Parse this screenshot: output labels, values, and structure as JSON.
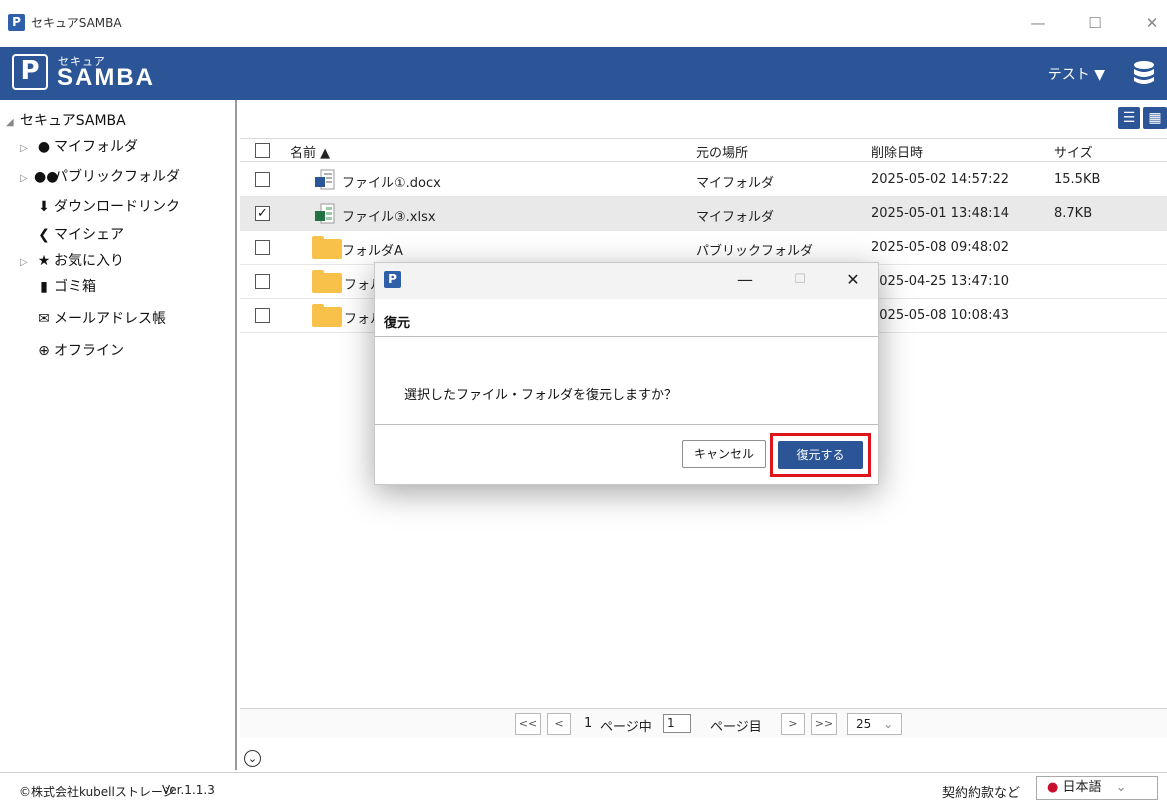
{
  "window": {
    "title": "セキュアSAMBA",
    "app_icon_glyph": "P",
    "controls": [
      "—",
      "☐",
      "✕"
    ]
  },
  "header": {
    "logo_sub": "セキュア",
    "logo_main": "SAMBA",
    "user": "テスト ▼",
    "icons": [
      "key-logo-icon",
      "database-icon"
    ],
    "bg_color": "#2b5596"
  },
  "sidebar": {
    "root": "セキュアSAMBA",
    "items": [
      {
        "label": "マイフォルダ",
        "icon": "user-icon",
        "glyph": "👤"
      },
      {
        "label": "パブリックフォルダ",
        "icon": "users-icon",
        "glyph": "👥"
      },
      {
        "label": "ダウンロードリンク",
        "icon": "download-icon",
        "glyph": "⬇"
      },
      {
        "label": "マイシェア",
        "icon": "share-icon",
        "glyph": "<"
      },
      {
        "label": "お気に入り",
        "icon": "star-icon",
        "glyph": "★"
      },
      {
        "label": "ゴミ箱",
        "icon": "trash-icon",
        "glyph": "🗑"
      },
      {
        "label": "メールアドレス帳",
        "icon": "mail-icon",
        "glyph": "✉"
      },
      {
        "label": "オフライン",
        "icon": "offline-icon",
        "glyph": "⊕"
      }
    ]
  },
  "table": {
    "columns": [
      "名前 ▲",
      "元の場所",
      "削除日時",
      "サイズ"
    ],
    "rows": [
      {
        "name": "ファイル①.docx",
        "location": "マイフォルダ",
        "deleted": "2025-05-02 14:57:22",
        "size": "15.5KB",
        "type": "docx",
        "checked": false
      },
      {
        "name": "ファイル③.xlsx",
        "location": "マイフォルダ",
        "deleted": "2025-05-01 13:48:14",
        "size": "8.7KB",
        "type": "xlsx",
        "checked": true
      },
      {
        "name": "フォルダA",
        "location": "パブリックフォルダ",
        "deleted": "2025-05-08 09:48:02",
        "size": "",
        "type": "folder",
        "checked": false
      },
      {
        "name": "フォル",
        "location": "",
        "deleted": "2025-04-25 13:47:10",
        "size": "",
        "type": "folder",
        "checked": false
      },
      {
        "name": "フォル",
        "location": "",
        "deleted": "2025-05-08 10:08:43",
        "size": "",
        "type": "folder",
        "checked": false
      }
    ]
  },
  "pager": {
    "first": "<<",
    "prev": "<",
    "total_prefix": "1",
    "of_label": "ページ中",
    "current": "1",
    "page_label": "ページ目",
    "next": ">",
    "last": ">>",
    "per_page": "25",
    "per_page_caret": "⌄"
  },
  "statusbar": {
    "copyright": "©株式会社kubellストレージ",
    "version": "Ver.1.1.3",
    "terms": "契約約款など",
    "language": "日本語",
    "lang_caret": "⌄"
  },
  "dialog": {
    "heading": "復元",
    "message": "選択したファイル・フォルダを復元しますか？",
    "cancel": "キャンセル",
    "confirm": "復元する",
    "controls": [
      "—",
      "☐",
      "✕"
    ],
    "highlight_color": "#e0141b"
  }
}
